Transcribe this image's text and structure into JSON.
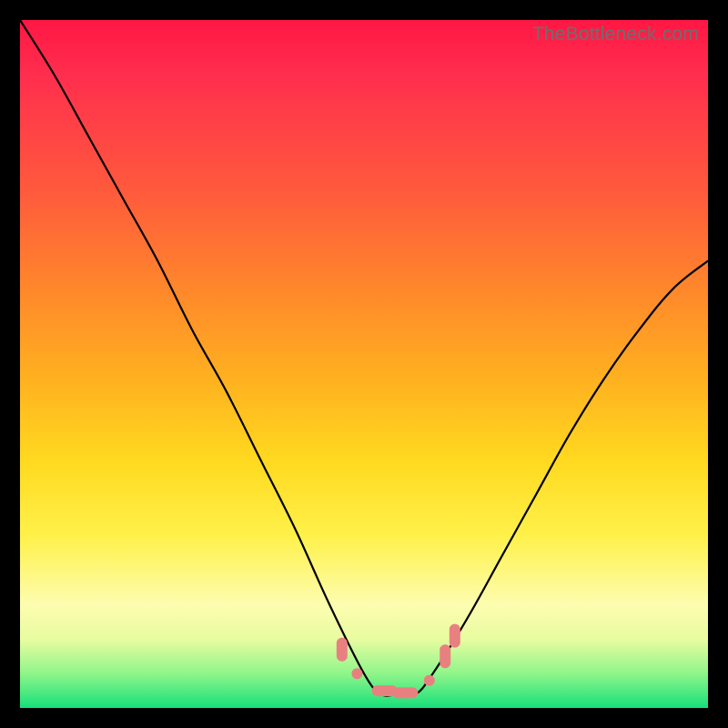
{
  "watermark": "TheBottleneck.com",
  "colors": {
    "curve": "#000000",
    "marker": "#e98080",
    "frame": "#000000"
  },
  "chart_data": {
    "type": "line",
    "title": "",
    "xlabel": "",
    "ylabel": "",
    "xlim": [
      0,
      1
    ],
    "ylim": [
      0,
      1
    ],
    "note": "No axes or tick labels are shown; values are normalized to the plot box (0=left/bottom, 1=right/top).",
    "series": [
      {
        "name": "bottleneck-curve",
        "x": [
          0.0,
          0.05,
          0.1,
          0.15,
          0.2,
          0.25,
          0.3,
          0.35,
          0.4,
          0.45,
          0.5,
          0.525,
          0.55,
          0.575,
          0.6,
          0.65,
          0.7,
          0.75,
          0.8,
          0.85,
          0.9,
          0.95,
          1.0
        ],
        "y": [
          1.0,
          0.92,
          0.83,
          0.74,
          0.65,
          0.55,
          0.46,
          0.36,
          0.26,
          0.15,
          0.05,
          0.02,
          0.02,
          0.02,
          0.05,
          0.13,
          0.22,
          0.31,
          0.4,
          0.48,
          0.55,
          0.61,
          0.65
        ]
      }
    ],
    "markers": [
      {
        "shape": "pill-vertical",
        "x": 0.468,
        "y": 0.085
      },
      {
        "shape": "dot",
        "x": 0.49,
        "y": 0.05
      },
      {
        "shape": "pill-horizontal",
        "x": 0.53,
        "y": 0.025
      },
      {
        "shape": "pill-horizontal",
        "x": 0.56,
        "y": 0.022
      },
      {
        "shape": "dot",
        "x": 0.595,
        "y": 0.04
      },
      {
        "shape": "pill-vertical",
        "x": 0.618,
        "y": 0.075
      },
      {
        "shape": "pill-vertical",
        "x": 0.632,
        "y": 0.105
      }
    ]
  }
}
